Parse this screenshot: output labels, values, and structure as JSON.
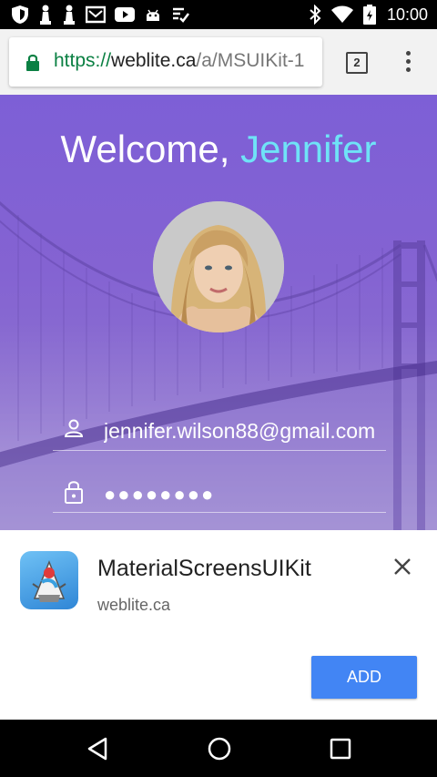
{
  "status_bar": {
    "time": "10:00",
    "left_icons": [
      "shield-icon",
      "chess-pawn-icon",
      "chess-pawn-icon",
      "mail-icon",
      "youtube-icon",
      "android-icon",
      "checklist-icon"
    ],
    "right_icons": [
      "bluetooth-icon",
      "wifi-icon",
      "battery-icon"
    ]
  },
  "browser": {
    "url_scheme": "https://",
    "url_host": "weblite.ca",
    "url_path": "/a/MSUIKit-1",
    "tab_count": "2",
    "accent": "#4285f4"
  },
  "login": {
    "welcome_prefix": "Welcome, ",
    "welcome_name": "Jennifer",
    "email": "jennifer.wilson88@gmail.com",
    "password_mask": "●●●●●●●●",
    "name_color": "#6fe3f7"
  },
  "install_sheet": {
    "app_name": "MaterialScreensUIKit",
    "site": "weblite.ca",
    "add_label": "ADD",
    "button_color": "#4285f4"
  },
  "nav_bar": {
    "buttons": [
      "back-icon",
      "home-icon",
      "recents-icon"
    ]
  }
}
